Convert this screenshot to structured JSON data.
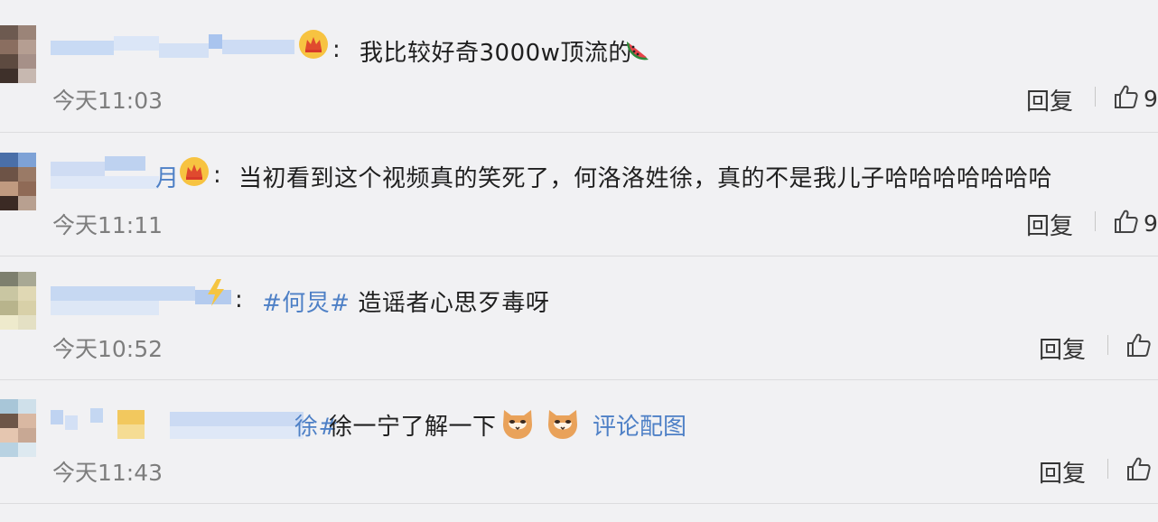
{
  "comments": [
    {
      "text": "我比较好奇3000w顶流的",
      "emoji": "watermelon-emoji",
      "time": "今天11:03",
      "reply_label": "回复",
      "like_count": "9",
      "badge": "crown-badge-icon"
    },
    {
      "username_tail": "月",
      "text": "当初看到这个视频真的笑死了，何洛洛姓徐，真的不是我儿子哈哈哈哈哈哈哈",
      "time": "今天11:11",
      "reply_label": "回复",
      "like_count": "9",
      "badge": "crown-badge-icon"
    },
    {
      "topic": "#何炅#",
      "text": "造谣者心思歹毒呀",
      "time": "今天10:52",
      "reply_label": "回复",
      "badge": "lightning-badge-icon"
    },
    {
      "topic_tail": "徐#",
      "text": "徐一宁了解一下",
      "emoji": "cat-face-emoji",
      "link": "评论配图",
      "time": "今天11:43",
      "reply_label": "回复"
    }
  ],
  "colon": ":",
  "colors": {
    "background": "#f1f1f3",
    "link": "#4e80c6",
    "time": "#7d7d7d",
    "divider": "#dcdcde"
  }
}
